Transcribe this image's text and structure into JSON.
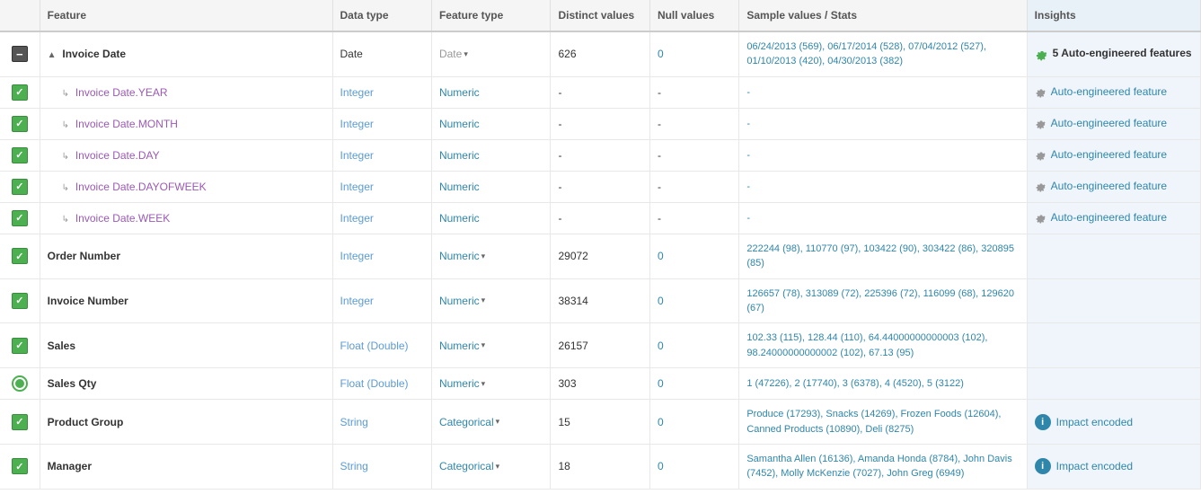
{
  "header": {
    "col_checkbox": "",
    "col_feature": "Feature",
    "col_datatype": "Data type",
    "col_featuretype": "Feature type",
    "col_distinct": "Distinct values",
    "col_null": "Null values",
    "col_sample": "Sample values / Stats",
    "col_insights": "Insights"
  },
  "rows": [
    {
      "id": "invoice-date",
      "checkbox": "minus",
      "feature_prefix": "▲",
      "feature_name": "Invoice Date",
      "feature_indent": false,
      "datatype": "Date",
      "datatype_class": "dtype-date",
      "featuretype": "Date",
      "featuretype_class": "ftype-date",
      "has_dropdown": true,
      "distinct": "626",
      "null_val": "0",
      "null_class": "null-zero",
      "sample": "06/24/2013 (569), 06/17/2014 (528), 07/04/2012 (527), 01/10/2013 (420), 04/30/2013 (382)",
      "insights_type": "auto-bold",
      "insights_text": "5 Auto-engineered features"
    },
    {
      "id": "invoice-date-year",
      "checkbox": "green",
      "feature_prefix": "↳",
      "feature_name": "Invoice Date.YEAR",
      "feature_indent": true,
      "datatype": "Integer",
      "datatype_class": "dtype-integer",
      "featuretype": "Numeric",
      "featuretype_class": "ftype-numeric",
      "has_dropdown": false,
      "distinct": "-",
      "null_val": "-",
      "null_class": "",
      "sample": "-",
      "insights_type": "auto-link",
      "insights_text": "Auto-engineered feature"
    },
    {
      "id": "invoice-date-month",
      "checkbox": "green",
      "feature_prefix": "↳",
      "feature_name": "Invoice Date.MONTH",
      "feature_indent": true,
      "datatype": "Integer",
      "datatype_class": "dtype-integer",
      "featuretype": "Numeric",
      "featuretype_class": "ftype-numeric",
      "has_dropdown": false,
      "distinct": "-",
      "null_val": "-",
      "null_class": "",
      "sample": "-",
      "insights_type": "auto-link",
      "insights_text": "Auto-engineered feature"
    },
    {
      "id": "invoice-date-day",
      "checkbox": "green",
      "feature_prefix": "↳",
      "feature_name": "Invoice Date.DAY",
      "feature_indent": true,
      "datatype": "Integer",
      "datatype_class": "dtype-integer",
      "featuretype": "Numeric",
      "featuretype_class": "ftype-numeric",
      "has_dropdown": false,
      "distinct": "-",
      "null_val": "-",
      "null_class": "",
      "sample": "-",
      "insights_type": "auto-link",
      "insights_text": "Auto-engineered feature"
    },
    {
      "id": "invoice-date-dayofweek",
      "checkbox": "green",
      "feature_prefix": "↳",
      "feature_name": "Invoice Date.DAYOFWEEK",
      "feature_indent": true,
      "datatype": "Integer",
      "datatype_class": "dtype-integer",
      "featuretype": "Numeric",
      "featuretype_class": "ftype-numeric",
      "has_dropdown": false,
      "distinct": "-",
      "null_val": "-",
      "null_class": "",
      "sample": "-",
      "insights_type": "auto-link",
      "insights_text": "Auto-engineered feature"
    },
    {
      "id": "invoice-date-week",
      "checkbox": "green",
      "feature_prefix": "↳",
      "feature_name": "Invoice Date.WEEK",
      "feature_indent": true,
      "datatype": "Integer",
      "datatype_class": "dtype-integer",
      "featuretype": "Numeric",
      "featuretype_class": "ftype-numeric",
      "has_dropdown": false,
      "distinct": "-",
      "null_val": "-",
      "null_class": "",
      "sample": "-",
      "insights_type": "auto-link",
      "insights_text": "Auto-engineered feature"
    },
    {
      "id": "order-number",
      "checkbox": "green",
      "feature_prefix": "",
      "feature_name": "Order Number",
      "feature_indent": false,
      "datatype": "Integer",
      "datatype_class": "dtype-integer",
      "featuretype": "Numeric",
      "featuretype_class": "ftype-numeric",
      "has_dropdown": true,
      "distinct": "29072",
      "null_val": "0",
      "null_class": "null-zero",
      "sample": "222244 (98), 110770 (97), 103422 (90), 303422 (86), 320895 (85)",
      "insights_type": "none",
      "insights_text": ""
    },
    {
      "id": "invoice-number",
      "checkbox": "green",
      "feature_prefix": "",
      "feature_name": "Invoice Number",
      "feature_indent": false,
      "datatype": "Integer",
      "datatype_class": "dtype-integer",
      "featuretype": "Numeric",
      "featuretype_class": "ftype-numeric",
      "has_dropdown": true,
      "distinct": "38314",
      "null_val": "0",
      "null_class": "null-zero",
      "sample": "126657 (78), 313089 (72), 225396 (72), 116099 (68), 129620 (67)",
      "insights_type": "none",
      "insights_text": ""
    },
    {
      "id": "sales",
      "checkbox": "green",
      "feature_prefix": "",
      "feature_name": "Sales",
      "feature_indent": false,
      "datatype": "Float (Double)",
      "datatype_class": "dtype-float",
      "featuretype": "Numeric",
      "featuretype_class": "ftype-numeric",
      "has_dropdown": true,
      "distinct": "26157",
      "null_val": "0",
      "null_class": "null-zero",
      "sample": "102.33 (115), 128.44 (110), 64.44000000000003 (102), 98.24000000000002 (102), 67.13 (95)",
      "insights_type": "none",
      "insights_text": ""
    },
    {
      "id": "sales-qty",
      "checkbox": "target",
      "feature_prefix": "",
      "feature_name": "Sales Qty",
      "feature_indent": false,
      "datatype": "Float (Double)",
      "datatype_class": "dtype-float",
      "featuretype": "Numeric",
      "featuretype_class": "ftype-numeric",
      "has_dropdown": true,
      "distinct": "303",
      "null_val": "0",
      "null_class": "null-zero",
      "sample": "1 (47226), 2 (17740), 3 (6378), 4 (4520), 5 (3122)",
      "insights_type": "none",
      "insights_text": ""
    },
    {
      "id": "product-group",
      "checkbox": "green",
      "feature_prefix": "",
      "feature_name": "Product Group",
      "feature_indent": false,
      "datatype": "String",
      "datatype_class": "dtype-string",
      "featuretype": "Categorical",
      "featuretype_class": "ftype-categorical",
      "has_dropdown": true,
      "distinct": "15",
      "null_val": "0",
      "null_class": "null-zero",
      "sample": "Produce (17293), Snacks (14269), Frozen Foods (12604), Canned Products (10890), Deli (8275)",
      "insights_type": "impact",
      "insights_text": "Impact encoded"
    },
    {
      "id": "manager",
      "checkbox": "green",
      "feature_prefix": "",
      "feature_name": "Manager",
      "feature_indent": false,
      "datatype": "String",
      "datatype_class": "dtype-string",
      "featuretype": "Categorical",
      "featuretype_class": "ftype-categorical",
      "has_dropdown": true,
      "distinct": "18",
      "null_val": "0",
      "null_class": "null-zero",
      "sample": "Samantha Allen (16136), Amanda Honda (8784), John Davis (7452), Molly McKenzie (7027), John Greg (6949)",
      "insights_type": "impact",
      "insights_text": "Impact encoded"
    }
  ]
}
